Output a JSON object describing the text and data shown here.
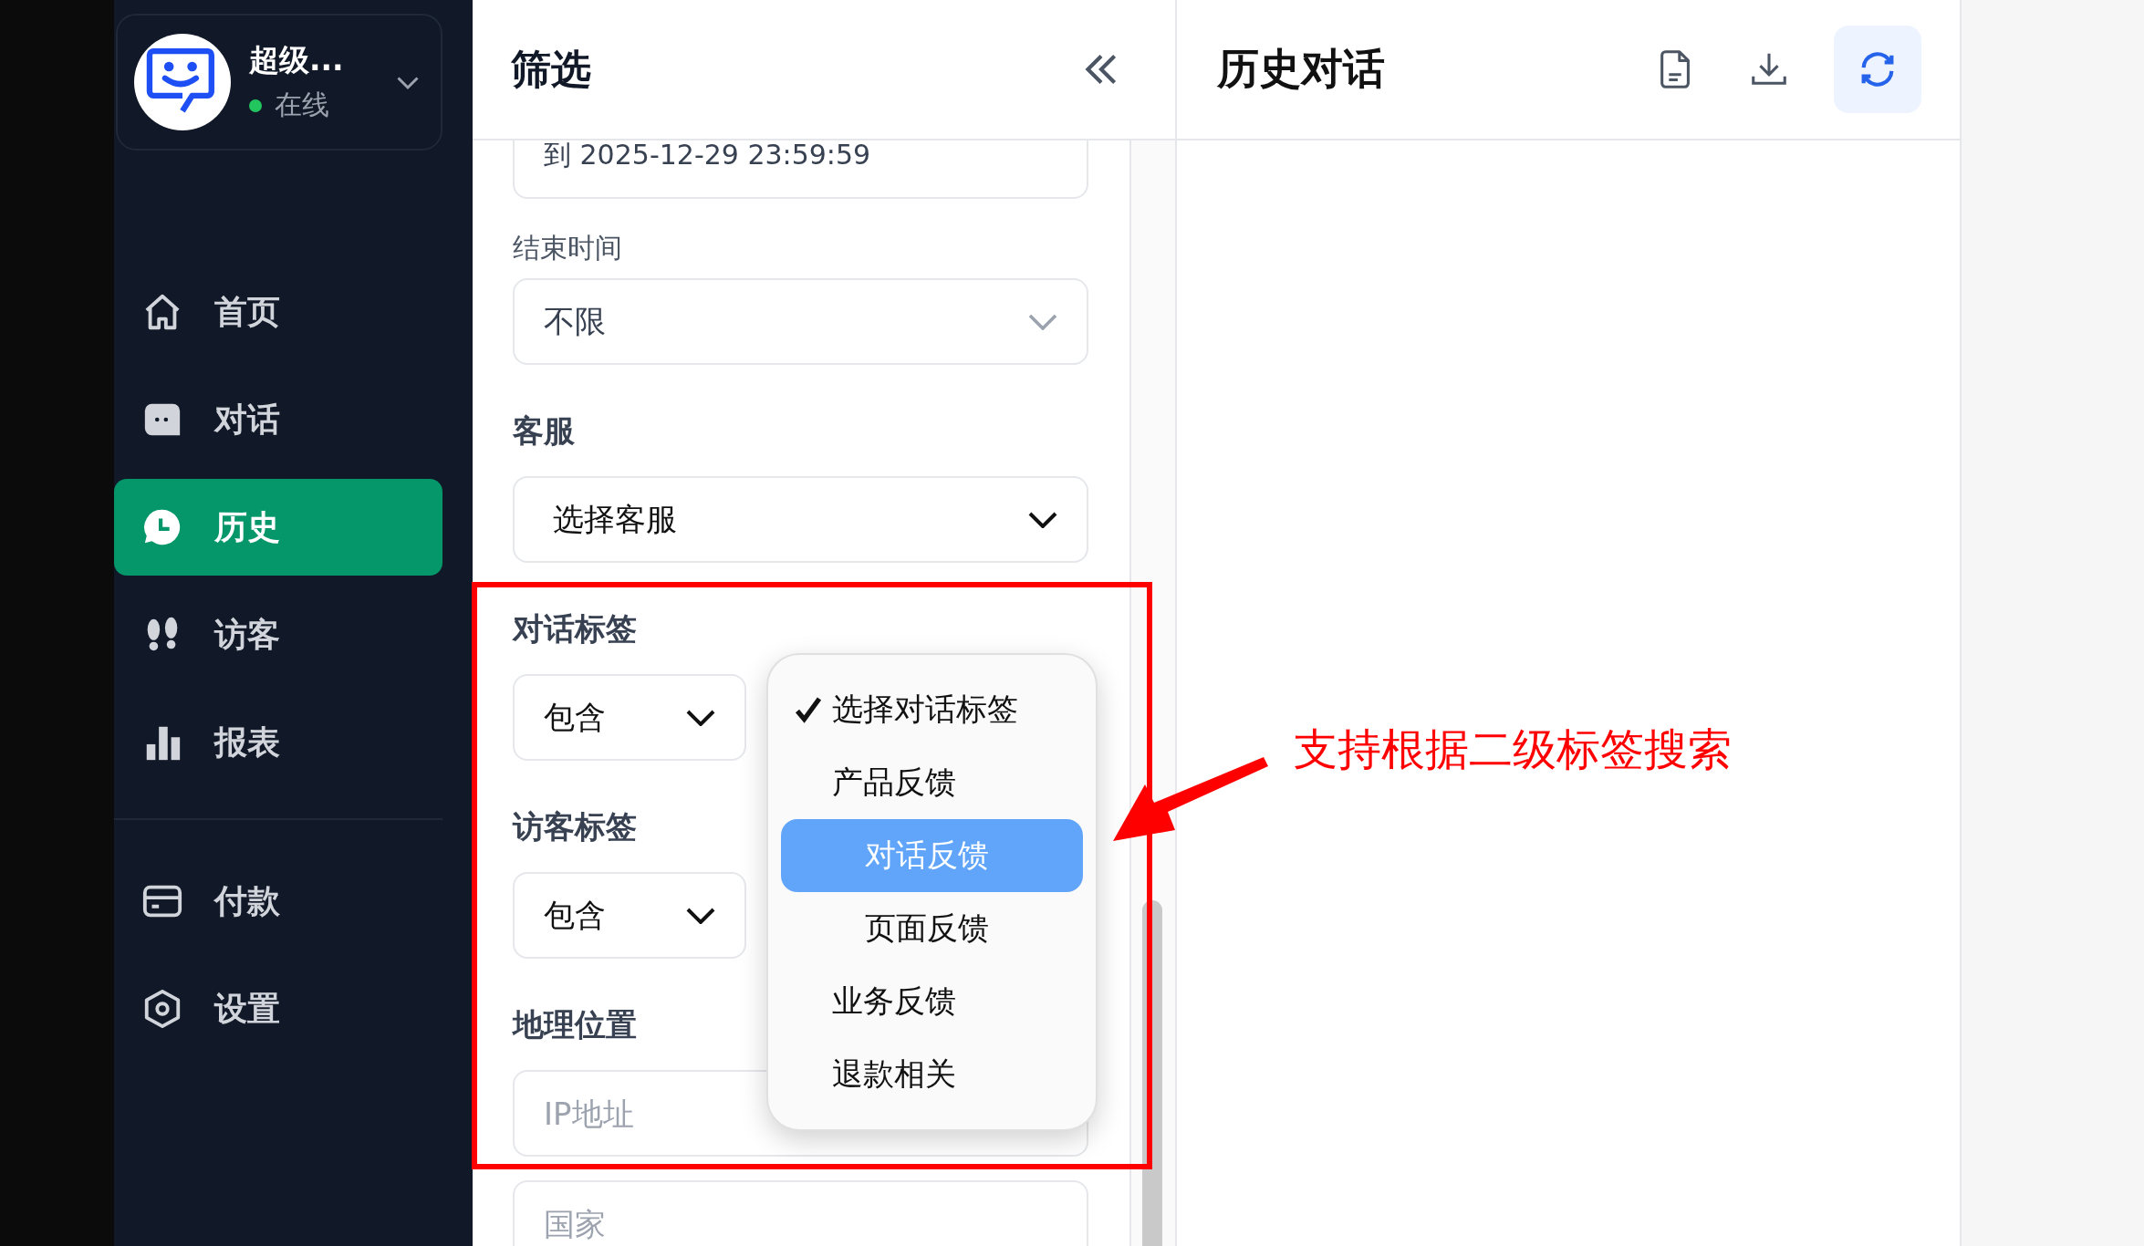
{
  "sidebar": {
    "user": {
      "name": "超级...",
      "status": "在线",
      "online": true
    },
    "sections": [
      {
        "items": [
          {
            "label": "首页",
            "selected": false
          },
          {
            "label": "对话",
            "selected": false
          },
          {
            "label": "历史",
            "selected": true
          },
          {
            "label": "访客",
            "selected": false
          },
          {
            "label": "报表",
            "selected": false
          }
        ]
      },
      {
        "items": [
          {
            "label": "付款",
            "selected": false
          },
          {
            "label": "设置",
            "selected": false
          }
        ]
      }
    ]
  },
  "filter": {
    "title": "筛选",
    "start_value": "到 2025-12-29 23:59:59",
    "end_time": {
      "label": "结束时间",
      "value": "不限"
    },
    "agent": {
      "label": "客服",
      "value": "选择客服"
    },
    "conversation_tags": {
      "label": "对话标签",
      "mode": "包含"
    },
    "visitor_tags": {
      "label": "访客标签",
      "mode": "包含"
    },
    "location": {
      "label": "地理位置",
      "fields": [
        {
          "placeholder": "IP地址"
        },
        {
          "placeholder": "国家"
        }
      ]
    },
    "tag_dropdown": {
      "options": [
        {
          "label": "选择对话标签",
          "checked": true,
          "selected": false
        },
        {
          "label": "产品反馈",
          "checked": false,
          "selected": false,
          "children": [
            {
              "label": "对话反馈",
              "checked": false,
              "selected": true
            },
            {
              "label": "页面反馈",
              "checked": false,
              "selected": false
            }
          ]
        },
        {
          "label": "业务反馈",
          "checked": false,
          "selected": false
        },
        {
          "label": "退款相关",
          "checked": false,
          "selected": false
        }
      ]
    }
  },
  "history": {
    "title": "历史对话"
  },
  "annotation": {
    "text": "支持根据二级标签搜索"
  }
}
